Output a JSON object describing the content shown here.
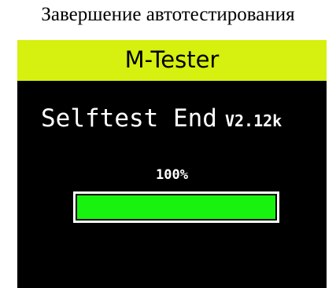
{
  "caption": "Завершение автотестирования",
  "device": {
    "app_title": "M-Tester",
    "status_text": "Selftest End",
    "version": "V2.12k",
    "progress": {
      "label": "100%",
      "fraction": 1.0
    }
  },
  "colors": {
    "header_bg": "#d6f00f",
    "screen_bg": "#000000",
    "progress_fill": "#18f20f",
    "text_on_screen": "#ffffff"
  }
}
